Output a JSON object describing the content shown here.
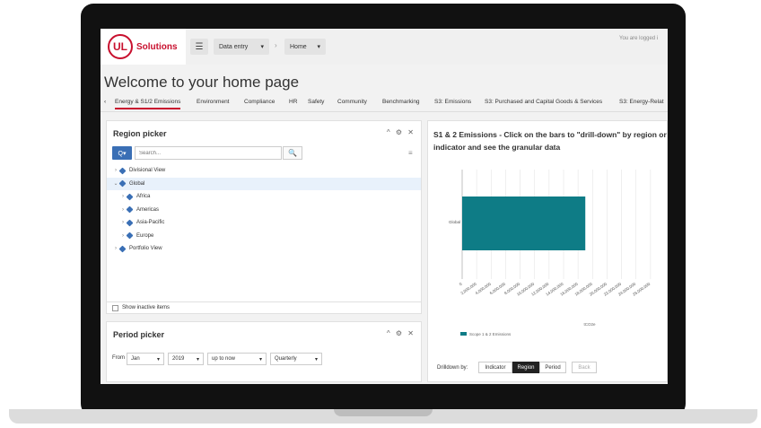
{
  "topbar": {
    "logo_mark": "UL",
    "logo_text": "Solutions",
    "menu_icon": "hamburger-icon",
    "data_entry": "Data entry",
    "home": "Home",
    "crumb_sep": "›",
    "logged_in": "You are logged i"
  },
  "page": {
    "title": "Welcome to your home page"
  },
  "tabs": {
    "prev": "‹",
    "items": [
      "Energy & S1/2 Emissions",
      "Environment",
      "Compliance",
      "HR",
      "Safety",
      "Community",
      "Benchmarking",
      "S3: Emissions",
      "S3: Purchased and Capital Goods & Services",
      "S3: Energy-Relat"
    ]
  },
  "region_picker": {
    "title": "Region picker",
    "tools": "^ ⚙ ✕",
    "search_btn": "Q▾",
    "search_placeholder": "Search...",
    "search_icon": "🔍",
    "list_icon": "≡",
    "tree": [
      {
        "label": "Divisional View",
        "caret": "›",
        "indent": 0
      },
      {
        "label": "Global",
        "caret": "⌄",
        "indent": 0,
        "selected": true
      },
      {
        "label": "Africa",
        "caret": "›",
        "indent": 1
      },
      {
        "label": "Americas",
        "caret": "›",
        "indent": 1
      },
      {
        "label": "Asia-Pacific",
        "caret": "›",
        "indent": 1
      },
      {
        "label": "Europe",
        "caret": "›",
        "indent": 1
      },
      {
        "label": "Portfolio View",
        "caret": "›",
        "indent": 0
      }
    ],
    "show_inactive": "Show inactive items"
  },
  "period_picker": {
    "title": "Period picker",
    "tools": "^ ⚙ ✕",
    "from_label": "From",
    "month": "Jan",
    "year": "2019",
    "range": "up to now",
    "granularity": "Quarterly",
    "caret": "▾"
  },
  "chart_panel": {
    "title": "S1 & 2 Emissions - Click on the bars to \"drill-down\" by region or indicator and see the granular data",
    "drilldown_label": "Drilldown by:",
    "buttons": [
      "Indicator",
      "Region",
      "Period"
    ],
    "active": "Region",
    "back": "Back"
  },
  "chart_data": {
    "type": "bar",
    "orientation": "horizontal",
    "categories": [
      "Global"
    ],
    "series": [
      {
        "name": "Scope 1 & 2 Emissions",
        "values": [
          17000000
        ],
        "color": "#0e7c86"
      }
    ],
    "xlim": [
      0,
      28000000
    ],
    "xticks": [
      "0",
      "2,000,000",
      "4,000,000",
      "6,000,000",
      "8,000,000",
      "10,000,000",
      "12,000,000",
      "14,000,000",
      "16,000,000",
      "18,000,000",
      "20,000,000",
      "22,000,000",
      "24,000,000",
      "26,000,000"
    ],
    "xlabel": "tCO2e",
    "grid": true,
    "legend_placement": "bottom-left"
  },
  "colors": {
    "accent": "#c8102e",
    "primary": "#3a6fb5",
    "bar": "#0e7c86"
  }
}
